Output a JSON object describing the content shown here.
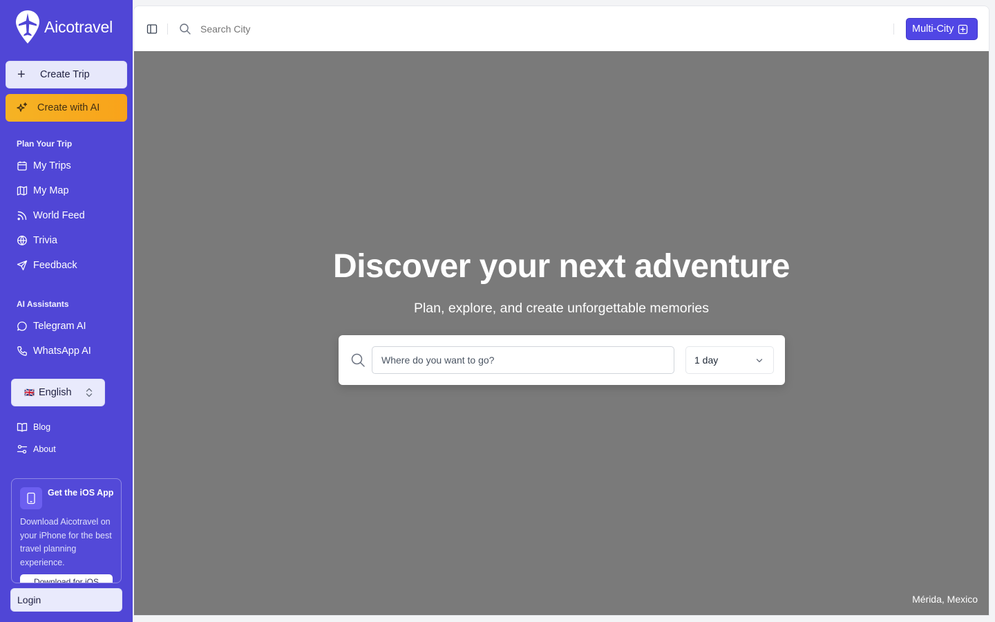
{
  "app": {
    "name": "Aicotravel"
  },
  "sidebar": {
    "create_trip": "Create Trip",
    "create_ai": "Create with AI",
    "plan_section": "Plan Your Trip",
    "plan_items": [
      {
        "label": "My Trips",
        "icon": "calendar-icon"
      },
      {
        "label": "My Map",
        "icon": "map-icon"
      },
      {
        "label": "World Feed",
        "icon": "rss-icon"
      },
      {
        "label": "Trivia",
        "icon": "globe-icon"
      },
      {
        "label": "Feedback",
        "icon": "send-icon"
      }
    ],
    "ai_section": "AI Assistants",
    "ai_items": [
      {
        "label": "Telegram AI",
        "icon": "chat-bubble-icon"
      },
      {
        "label": "WhatsApp AI",
        "icon": "phone-icon"
      }
    ],
    "language": {
      "flag": "🇬🇧",
      "label": "English"
    },
    "links": [
      {
        "label": "Blog",
        "icon": "book-icon"
      },
      {
        "label": "About",
        "icon": "sliders-icon"
      }
    ],
    "ios_card": {
      "title": "Get the iOS App",
      "description": "Download Aicotravel on your iPhone for the best travel planning experience.",
      "button": "Download for iOS"
    },
    "login": "Login",
    "colors": {
      "background": "#5046d6",
      "ai_button": "#f9a31a"
    }
  },
  "topbar": {
    "search_placeholder": "Search City",
    "multi_city": "Multi-City"
  },
  "hero": {
    "title": "Discover your next adventure",
    "subtitle": "Plan, explore, and create unforgettable memories",
    "destination_placeholder": "Where do you want to go?",
    "duration": "1 day",
    "location": "Mérida, Mexico"
  }
}
